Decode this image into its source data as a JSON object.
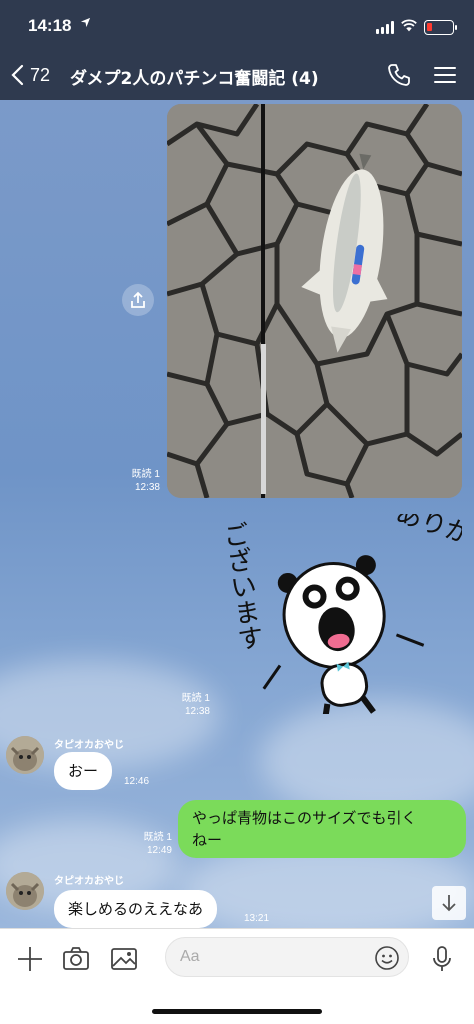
{
  "status": {
    "time": "14:18",
    "location_icon": "location-arrow-icon",
    "battery_color": "#ff3b30"
  },
  "header": {
    "back_count": "72",
    "title": "ダメプ2人のパチンコ奮闘記 (4)"
  },
  "messages": {
    "photo_read": "既読 1",
    "photo_time": "12:38",
    "sticker_text_1": "ありがとう",
    "sticker_text_2": "ございます",
    "sticker_read": "既読 1",
    "sticker_time": "12:38",
    "sender_1": "タピオカおやじ",
    "msg_1": "おー",
    "msg_1_time": "12:46",
    "own_read": "既読 1",
    "own_time": "12:49",
    "own_line_1": "やっぱ青物はこのサイズでも引く",
    "own_line_2": "ねー",
    "sender_2": "タピオカおやじ",
    "msg_2": "楽しめるのええなあ",
    "msg_2_time": "13:21"
  },
  "input": {
    "placeholder": "Aa"
  },
  "colors": {
    "header_bg": "#2f3a4f",
    "own_bubble": "#7bdb5a",
    "other_bubble": "#ffffff",
    "chat_bg": "#7a9ac8"
  }
}
